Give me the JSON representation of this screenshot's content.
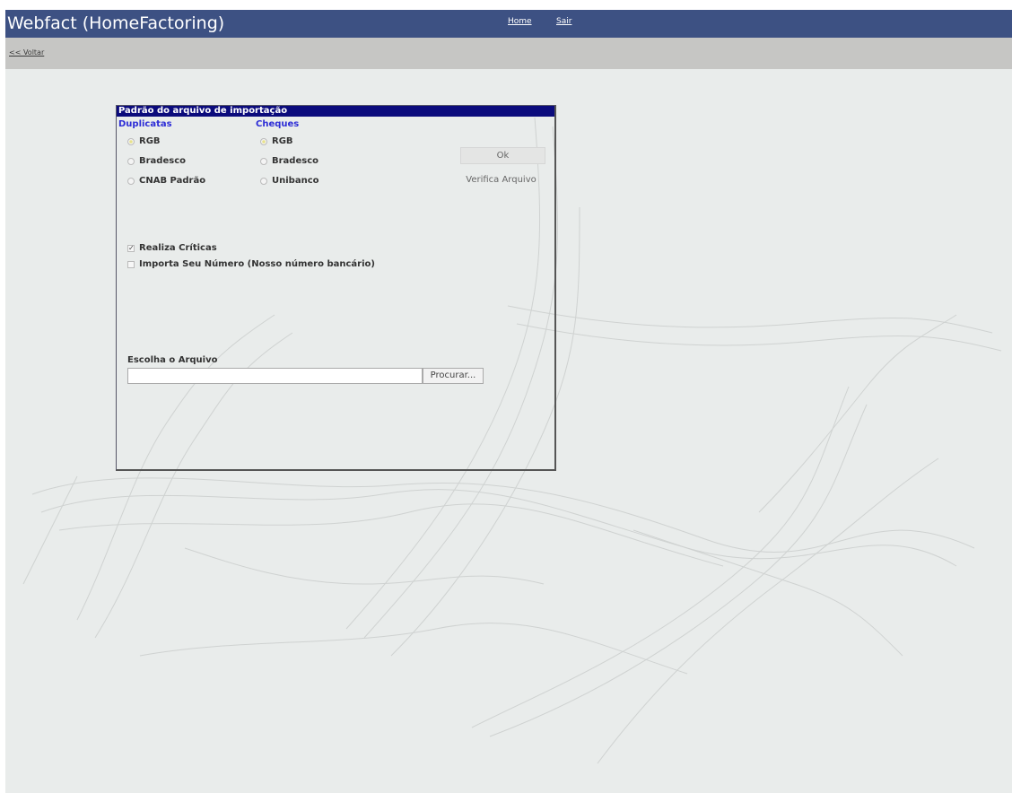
{
  "app": {
    "title": "Webfact (HomeFactoring)"
  },
  "topnav": {
    "home_label": "Home",
    "exit_label": "Sair"
  },
  "subbar": {
    "back_label": "<< Voltar"
  },
  "dialog": {
    "title": "Padrão do arquivo de importação",
    "duplicatas": {
      "heading": "Duplicatas",
      "options": [
        "RGB",
        "Bradesco",
        "CNAB Padrão"
      ],
      "selected": "RGB"
    },
    "cheques": {
      "heading": "Cheques",
      "options": [
        "RGB",
        "Bradesco",
        "Unibanco"
      ],
      "selected": "RGB"
    },
    "ok_label": "Ok",
    "verify_label": "Verifica Arquivo",
    "checkboxes": [
      {
        "label": "Realiza Críticas",
        "checked": true
      },
      {
        "label": "Importa Seu Número (Nosso número bancário)",
        "checked": false
      }
    ],
    "file": {
      "label": "Escolha o Arquivo",
      "value": "",
      "browse_label": "Procurar..."
    }
  },
  "colors": {
    "topbar": "#3d5183",
    "subbar": "#c6c6c4",
    "page_bg": "#e9eceb",
    "dialog_title_bg": "#0b0b7c",
    "group_heading": "#2d2dd6"
  }
}
